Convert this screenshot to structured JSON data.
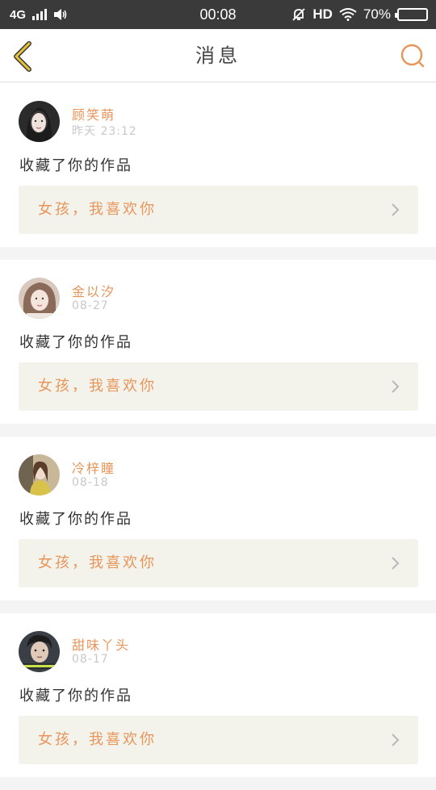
{
  "status_bar": {
    "network": "4G",
    "time": "00:08",
    "hd_label": "HD",
    "battery_percent": "70%",
    "battery_level": 0.7,
    "icons": [
      "signal-icon",
      "sound-icon",
      "bell-off-icon",
      "wifi-icon",
      "battery-icon"
    ]
  },
  "header": {
    "title": "消息",
    "back_icon": "chevron-left-icon",
    "search_icon": "search-icon",
    "accent_color": "#e8955a",
    "back_color": "#c9a420"
  },
  "messages": [
    {
      "username": "顾笑萌",
      "timestamp": "昨天 23:12",
      "action": "收藏了你的作品",
      "work_title": "女孩，我喜欢你"
    },
    {
      "username": "金以汐",
      "timestamp": "08-27",
      "action": "收藏了你的作品",
      "work_title": "女孩，我喜欢你"
    },
    {
      "username": "冷梓瞳",
      "timestamp": "08-18",
      "action": "收藏了你的作品",
      "work_title": "女孩，我喜欢你"
    },
    {
      "username": "甜味丫头",
      "timestamp": "08-17",
      "action": "收藏了你的作品",
      "work_title": "女孩，我喜欢你"
    }
  ]
}
